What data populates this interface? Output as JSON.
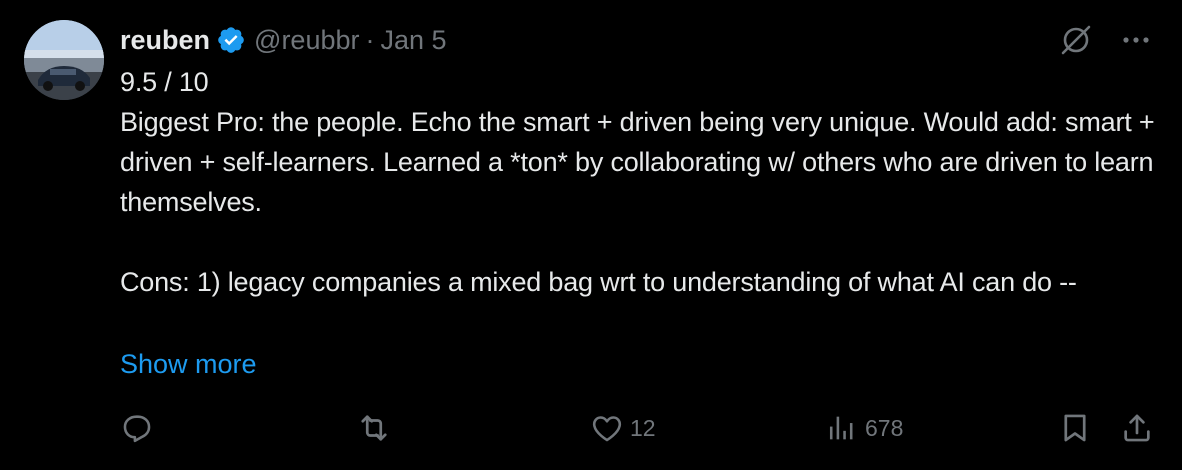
{
  "author": {
    "name": "reuben",
    "handle": "@reubbr",
    "separator": "·",
    "date": "Jan 5",
    "verified": true
  },
  "post": {
    "lines": "9.5 / 10\nBiggest Pro: the people. Echo the smart + driven being very unique. Would add: smart + driven + self-learners. Learned a *ton* by collaborating w/ others who are driven to learn themselves.\n\nCons: 1) legacy companies a mixed bag wrt to understanding of what AI can do --",
    "show_more": "Show more"
  },
  "actions": {
    "reply_count": "",
    "repost_count": "",
    "like_count": "12",
    "views_count": "678"
  },
  "colors": {
    "background": "#000000",
    "text": "#e7e9ea",
    "muted": "#71767b",
    "link": "#1d9bf0",
    "verified": "#1d9bf0"
  },
  "icons": {
    "verified": "verified-badge-icon",
    "grok": "grok-icon",
    "more": "more-horizontal-icon",
    "reply": "reply-icon",
    "repost": "repost-icon",
    "like": "heart-icon",
    "views": "views-icon",
    "bookmark": "bookmark-icon",
    "share": "share-icon"
  }
}
